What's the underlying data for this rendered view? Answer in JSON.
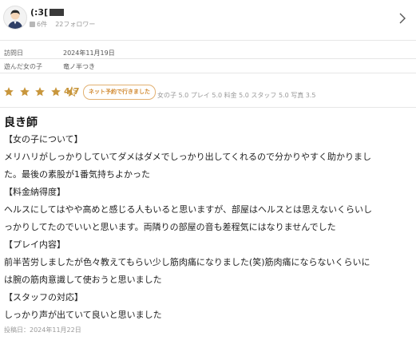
{
  "colors": {
    "star": "#c8963c",
    "badge_text": "#d28a32",
    "badge_border": "#e2b071",
    "muted_text": "#999999",
    "divider": "#e6e6e6"
  },
  "header": {
    "user_name": "(:3[",
    "user_name_masked": true,
    "posts": "6件",
    "followers": "22フォロワー",
    "icons": {
      "avatar": "avatar-icon",
      "posts": "document-icon",
      "chevron": "chevron-right-icon"
    }
  },
  "meta": {
    "visit_label": "訪問日",
    "visit_date": "2024年11月19日",
    "girl_label": "遊んだ女の子",
    "girl_name": "竜ノ半つき"
  },
  "rating": {
    "stars_filled": 4.5,
    "stars_total": 5,
    "value": "4.7",
    "badge": "ネット予約で行きました",
    "scores_text": "女の子 5.0 プレイ 5.0 料金 5.0 スタッフ 5.0 写真 3.5"
  },
  "review": {
    "title": "良き師",
    "lines": [
      "【女の子について】",
      "メリハリがしっかりしていてダメはダメでしっかり出してくれるので分かりやすく助かりまし",
      "た。最後の素股が1番気持ちよかった",
      "【料金納得度】",
      "ヘルスにしてはやや高めと感じる人もいると思いますが、部屋はヘルスとは思えないくらいし",
      "っかりしてたのでいいと思います。両隣りの部屋の音も差程気にはなりませんでした",
      "【プレイ内容】",
      "前半苦労しましたが色々教えてもらい少し筋肉痛になりました(笑)筋肉痛にならないくらいに",
      "は腕の筋肉意識して使おうと思いました",
      "【スタッフの対応】",
      "しっかり声が出ていて良いと思いました"
    ],
    "posted": "投稿日：2024年11月22日"
  }
}
